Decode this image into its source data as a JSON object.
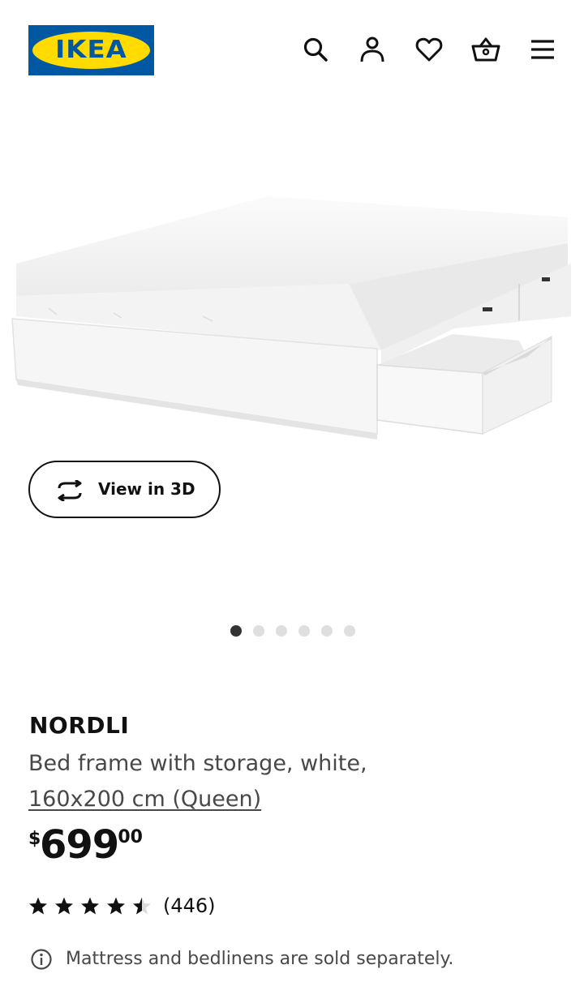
{
  "header": {
    "logo_text": "IKEA",
    "logo_reg": "®",
    "icons": [
      "search-icon",
      "account-icon",
      "heart-icon",
      "basket-icon",
      "menu-icon"
    ]
  },
  "gallery": {
    "view3d_label": "View in 3D",
    "dot_count": 6,
    "active_index": 0
  },
  "product": {
    "name": "NORDLI",
    "description": "Bed frame with storage, white,",
    "size": "160x200 cm (Queen)",
    "price": {
      "currency": "$",
      "integer": "699",
      "decimal": ".00"
    },
    "rating": {
      "stars": 4.5,
      "max": 5,
      "review_count": "(446)"
    },
    "note": "Mattress and bedlinens are sold separately."
  },
  "colors": {
    "brand_blue": "#0058a3",
    "brand_yellow": "#ffdb00",
    "text_primary": "#111111",
    "text_secondary": "#484848"
  }
}
